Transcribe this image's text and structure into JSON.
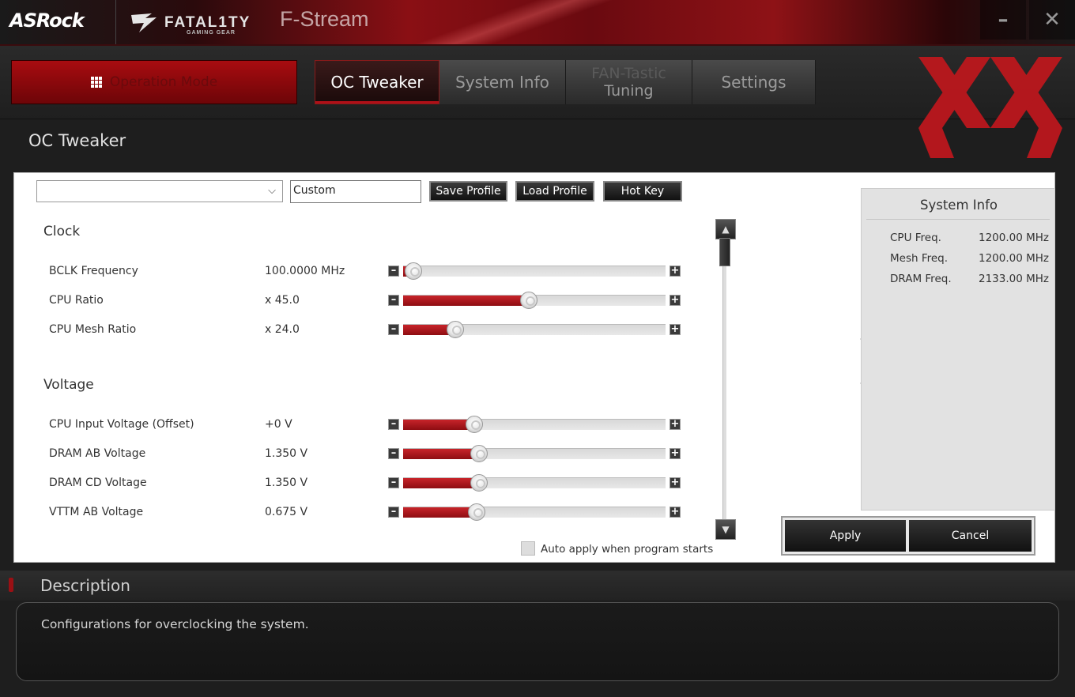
{
  "window": {
    "brand": "ASRock",
    "sub_brand": "FATAL1TY",
    "sub_brand_tagline": "GAMING GEAR",
    "app_title": "F-Stream"
  },
  "nav": {
    "operation_mode_label": "Operation Mode",
    "tabs": [
      {
        "label": "OC Tweaker",
        "active": true
      },
      {
        "label": "System Info",
        "active": false
      },
      {
        "label_line1": "FAN-Tastic",
        "label_line2": "Tuning",
        "active": false
      },
      {
        "label": "Settings",
        "active": false
      }
    ]
  },
  "page_title": "OC Tweaker",
  "profile": {
    "selected": "",
    "name_value": "Custom",
    "save_label": "Save Profile",
    "load_label": "Load Profile",
    "hotkey_label": "Hot Key"
  },
  "sections": {
    "clock": {
      "title": "Clock",
      "items": [
        {
          "label": "BCLK Frequency",
          "value": "100.0000 MHz",
          "level": 0.04
        },
        {
          "label": "CPU Ratio",
          "value": "x 45.0",
          "level": 0.48
        },
        {
          "label": "CPU Mesh Ratio",
          "value": "x 24.0",
          "level": 0.2
        }
      ]
    },
    "voltage": {
      "title": "Voltage",
      "items": [
        {
          "label": "CPU Input Voltage (Offset)",
          "value": "+0 V",
          "level": 0.27
        },
        {
          "label": "DRAM AB Voltage",
          "value": "1.350 V",
          "level": 0.29
        },
        {
          "label": "DRAM CD Voltage",
          "value": "1.350 V",
          "level": 0.29
        },
        {
          "label": "VTTM AB Voltage",
          "value": "0.675 V",
          "level": 0.28
        }
      ]
    }
  },
  "auto_apply": {
    "label": "Auto apply when program starts",
    "checked": false
  },
  "system_info": {
    "title": "System Info",
    "rows": [
      {
        "key": "CPU Freq.",
        "value": "1200.00 MHz"
      },
      {
        "key": "Mesh Freq.",
        "value": "1200.00 MHz"
      },
      {
        "key": "DRAM Freq.",
        "value": "2133.00 MHz"
      }
    ]
  },
  "actions": {
    "apply_label": "Apply",
    "cancel_label": "Cancel"
  },
  "description": {
    "title": "Description",
    "text": "Configurations for overclocking the system."
  },
  "colors": {
    "accent": "#b01018",
    "slider_fill": "#c8242a"
  }
}
